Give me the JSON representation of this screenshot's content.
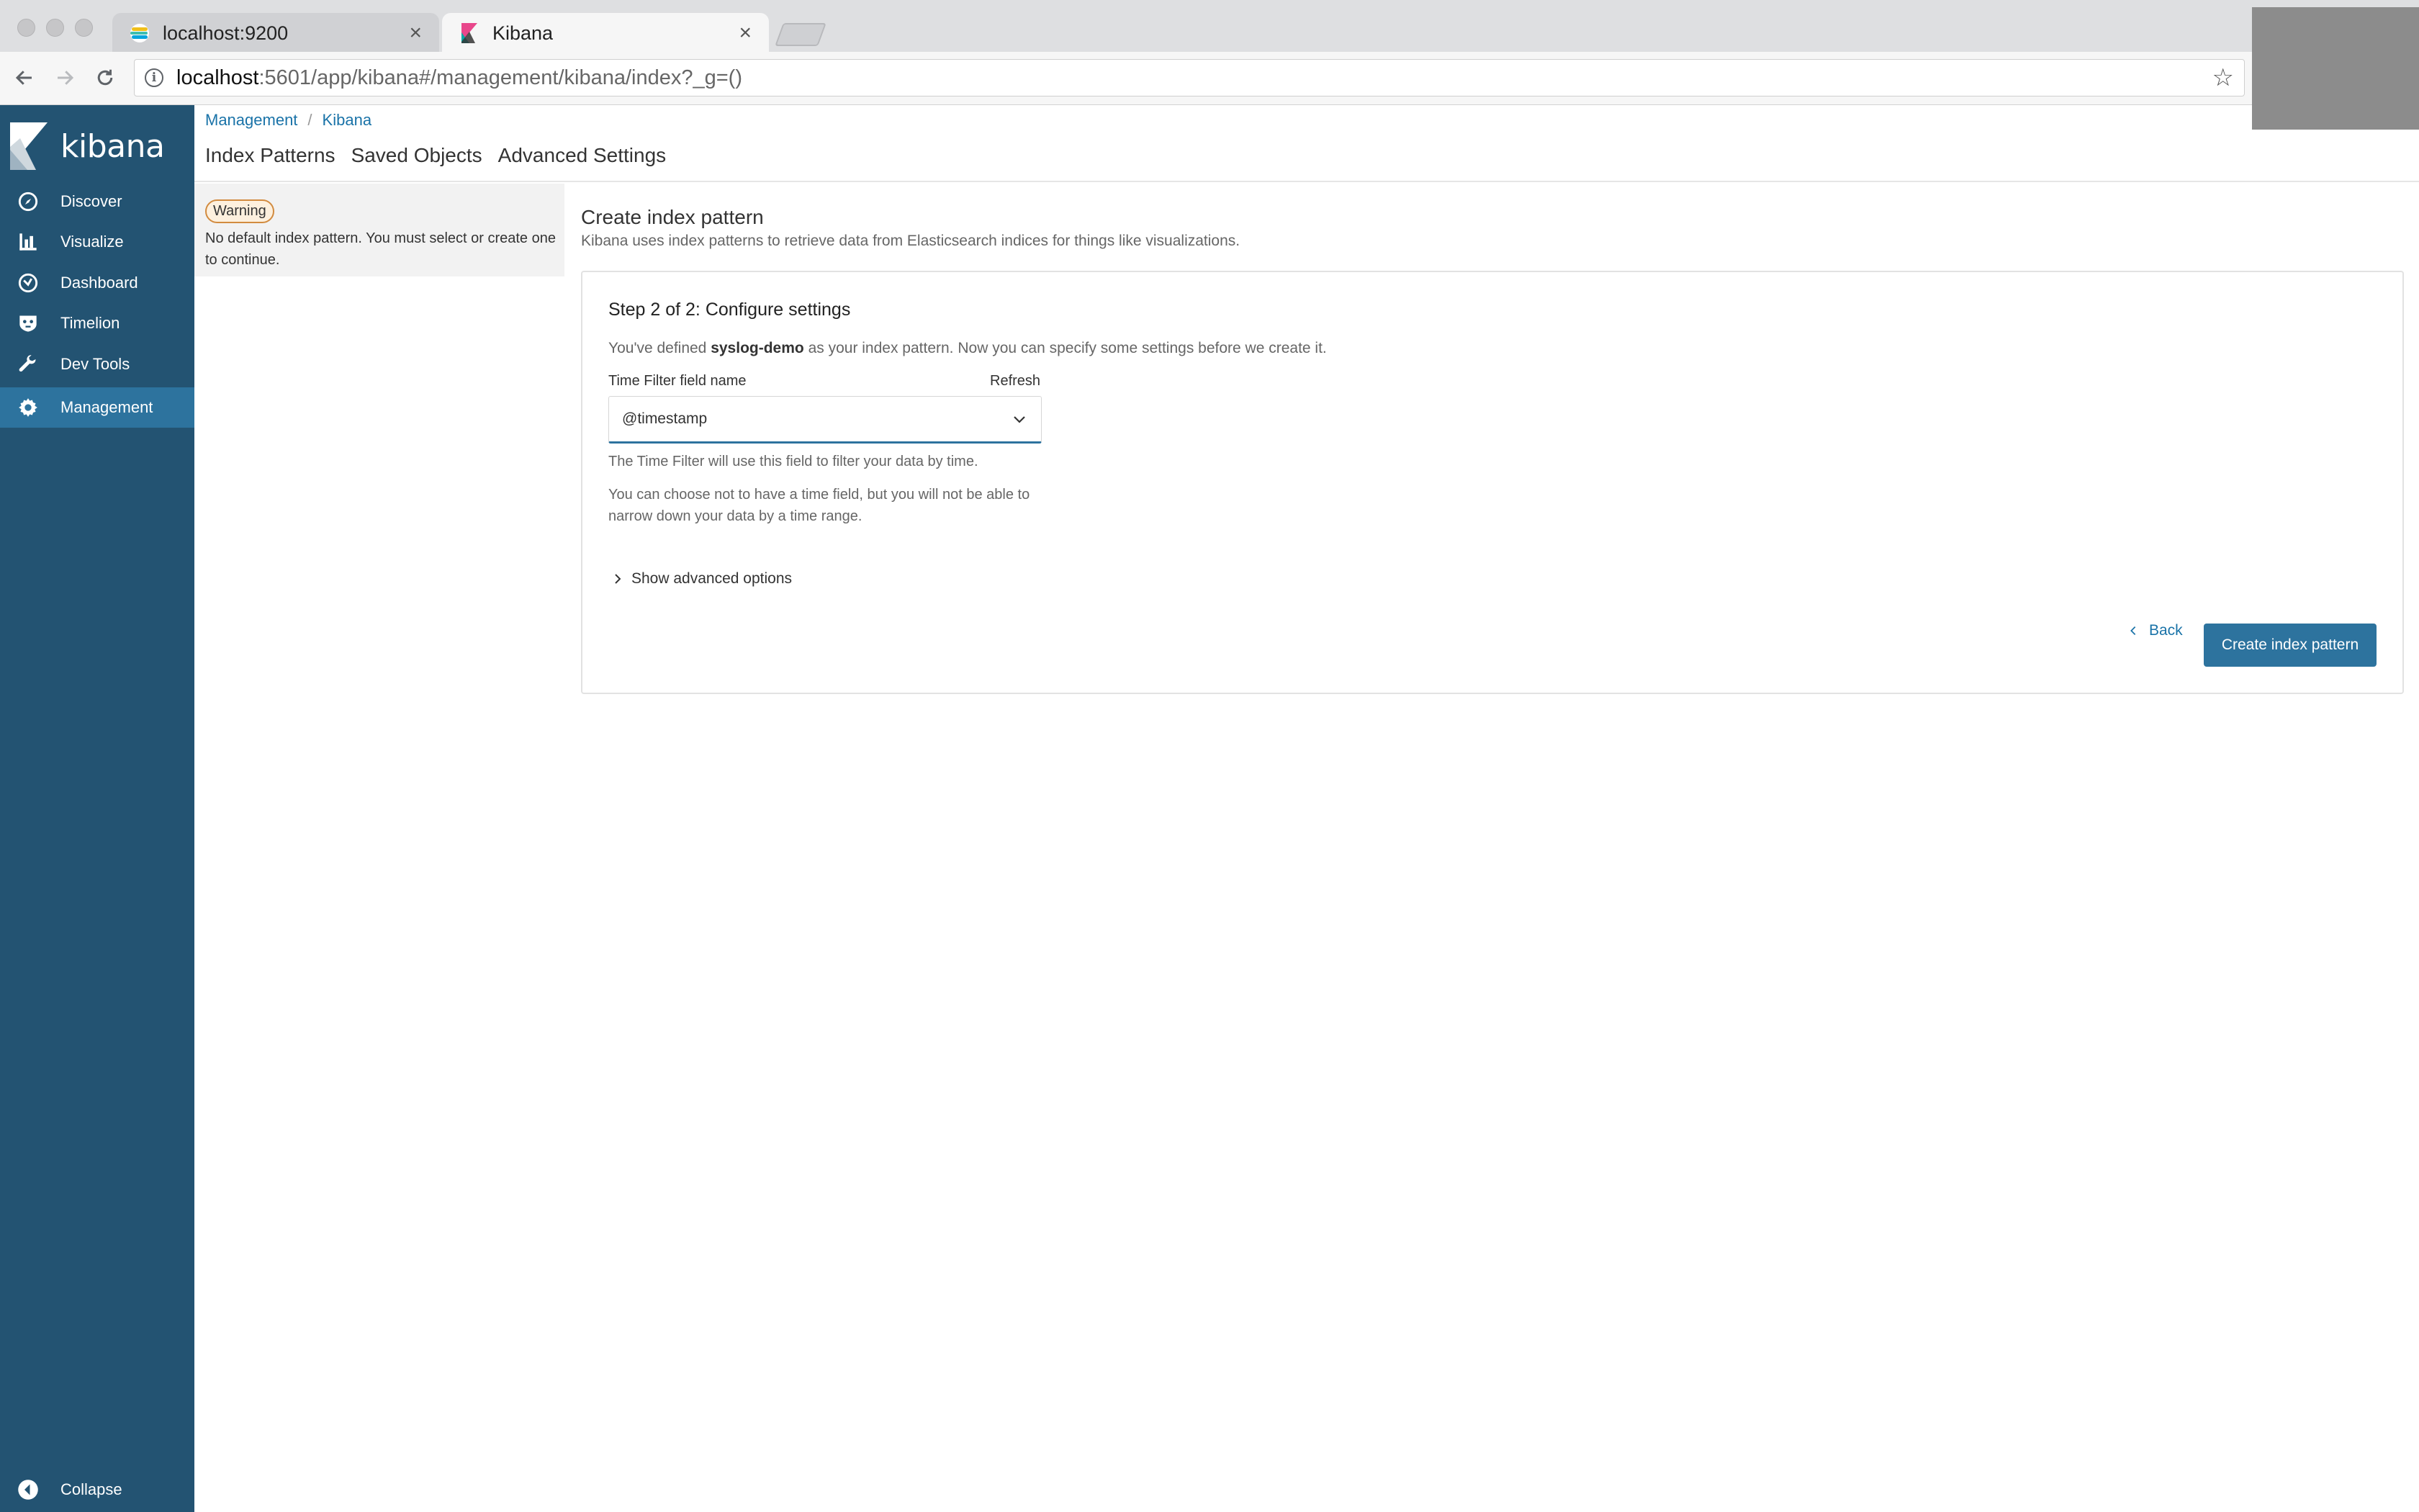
{
  "browser": {
    "tabs": [
      {
        "title": "localhost:9200"
      },
      {
        "title": "Kibana"
      }
    ],
    "url_host": "localhost",
    "url_path": ":5601/app/kibana#/management/kibana/index?_g=()"
  },
  "brand": {
    "name": "kibana"
  },
  "sidebar": {
    "items": [
      {
        "label": "Discover",
        "icon": "compass-icon"
      },
      {
        "label": "Visualize",
        "icon": "bar-chart-icon"
      },
      {
        "label": "Dashboard",
        "icon": "dashboard-icon"
      },
      {
        "label": "Timelion",
        "icon": "timelion-icon"
      },
      {
        "label": "Dev Tools",
        "icon": "wrench-icon"
      },
      {
        "label": "Management",
        "icon": "gear-icon",
        "active": true
      }
    ],
    "collapse_label": "Collapse"
  },
  "breadcrumb": {
    "items": [
      "Management",
      "Kibana"
    ],
    "separator": "/"
  },
  "subtabs": [
    "Index Patterns",
    "Saved Objects",
    "Advanced Settings"
  ],
  "warning": {
    "badge": "Warning",
    "text": "No default index pattern. You must select or create one to continue."
  },
  "create": {
    "title": "Create index pattern",
    "description": "Kibana uses index patterns to retrieve data from Elasticsearch indices for things like visualizations."
  },
  "step": {
    "title": "Step 2 of 2: Configure settings",
    "desc_prefix": "You've defined ",
    "pattern_name": "syslog-demo",
    "desc_suffix": " as your index pattern. Now you can specify some settings before we create it.",
    "time_filter_label": "Time Filter field name",
    "refresh_label": "Refresh",
    "time_field_value": "@timestamp",
    "help_1": "The Time Filter will use this field to filter your data by time.",
    "help_2": "You can choose not to have a time field, but you will not be able to narrow down your data by a time range.",
    "advanced_label": "Show advanced options",
    "back_label": "Back",
    "create_label": "Create index pattern"
  },
  "colors": {
    "sidebar_bg": "#235372",
    "sidebar_active": "#2d739e",
    "primary_button": "#2d739e",
    "link": "#1a73a8",
    "warning_border": "#d28b3f"
  }
}
